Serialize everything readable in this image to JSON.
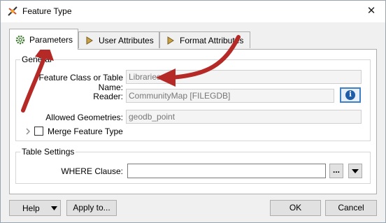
{
  "window": {
    "title": "Feature Type",
    "close_glyph": "✕"
  },
  "tabs": [
    {
      "label": "Parameters",
      "icon": "gear-icon"
    },
    {
      "label": "User Attributes",
      "icon": "arrow-right-icon"
    },
    {
      "label": "Format Attributes",
      "icon": "arrow-right-icon"
    }
  ],
  "general": {
    "group_label": "General",
    "feature_class_label": "Feature Class or Table Name:",
    "feature_class_value": "Libraries",
    "reader_label": "Reader:",
    "reader_value": "CommunityMap [FILEGDB]",
    "allowed_geometries_label": "Allowed Geometries:",
    "allowed_geometries_value": "geodb_point",
    "merge_label": "Merge Feature Type"
  },
  "table_settings": {
    "group_label": "Table Settings",
    "where_label": "WHERE Clause:",
    "where_value": "",
    "ellipsis": "..."
  },
  "footer": {
    "help": "Help",
    "apply_to": "Apply to...",
    "ok": "OK",
    "cancel": "Cancel"
  },
  "colors": {
    "annotation_arrow": "#b52a26",
    "info_blue": "#1e5aa8"
  }
}
